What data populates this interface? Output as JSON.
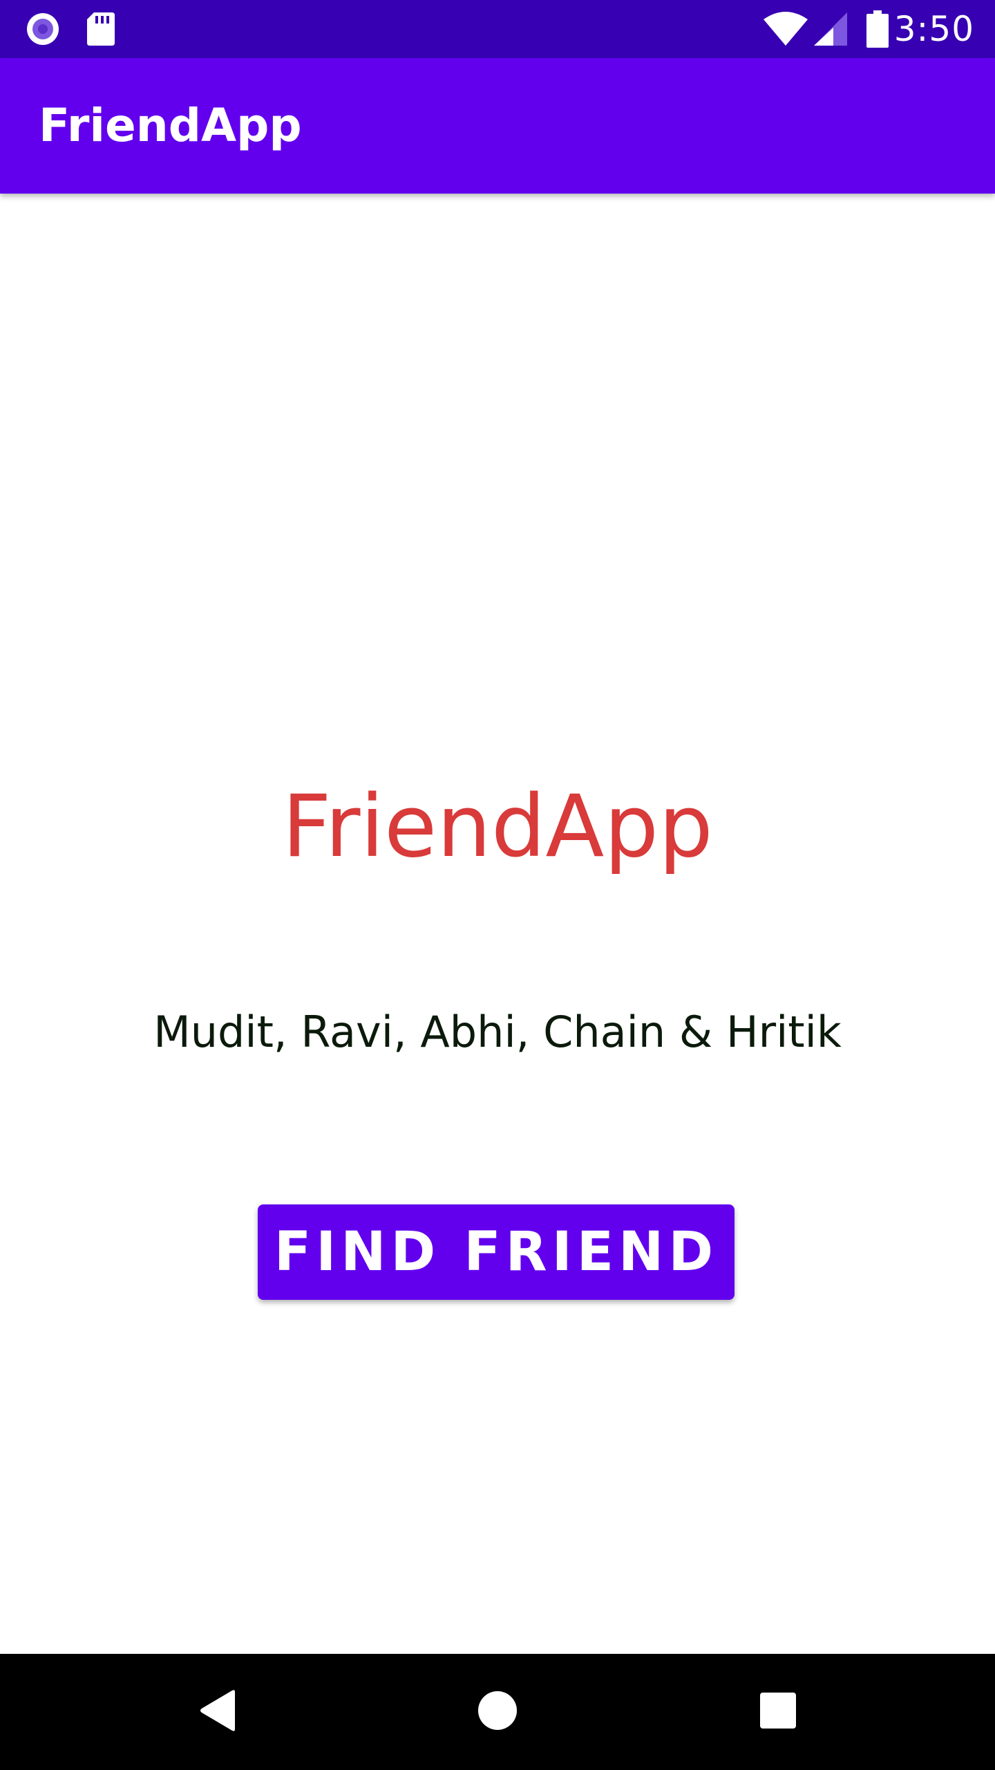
{
  "status_bar": {
    "time": "3:50",
    "icons": [
      "recording-icon",
      "sd-card-icon",
      "wifi-icon",
      "signal-icon",
      "battery-icon"
    ],
    "background_color": "#3700b3"
  },
  "app_bar": {
    "title": "FriendApp",
    "background_color": "#6200ee"
  },
  "main": {
    "heading": "FriendApp",
    "heading_color": "#d93a3a",
    "names": "Mudit, Ravi, Abhi, Chain & Hritik",
    "button_label": "FIND FRIEND",
    "button_color": "#6200ee"
  },
  "nav_bar": {
    "icons": [
      "back-icon",
      "home-icon",
      "recents-icon"
    ]
  }
}
